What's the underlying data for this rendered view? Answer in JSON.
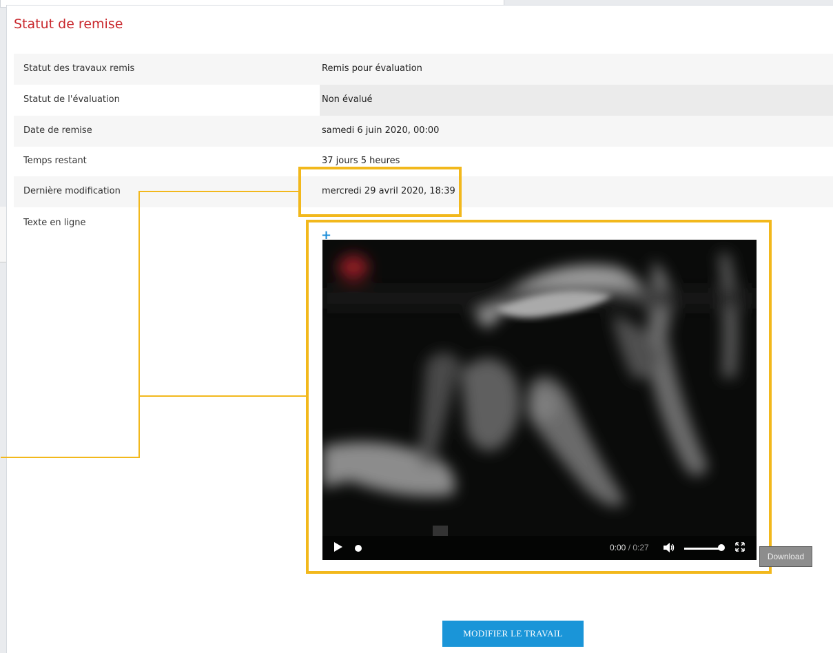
{
  "section_title": "Statut de remise",
  "rows": [
    {
      "label": "Statut des travaux remis",
      "value": "Remis pour évaluation"
    },
    {
      "label": "Statut de l'évaluation",
      "value": "Non évalué"
    },
    {
      "label": "Date de remise",
      "value": "samedi 6 juin 2020, 00:00"
    },
    {
      "label": "Temps restant",
      "value": "37 jours 5 heures"
    },
    {
      "label": "Dernière modification",
      "value": "mercredi 29 avril 2020, 18:39"
    },
    {
      "label": "Texte en ligne",
      "value": ""
    }
  ],
  "video": {
    "current_time": "0:00",
    "separator": " / ",
    "duration": "0:27"
  },
  "download_label": "Download",
  "edit_button_label": "MODIFIER LE TRAVAIL",
  "colors": {
    "title_red": "#c9282d",
    "highlight_yellow": "#f2b81c",
    "button_blue": "#1a95d8"
  }
}
